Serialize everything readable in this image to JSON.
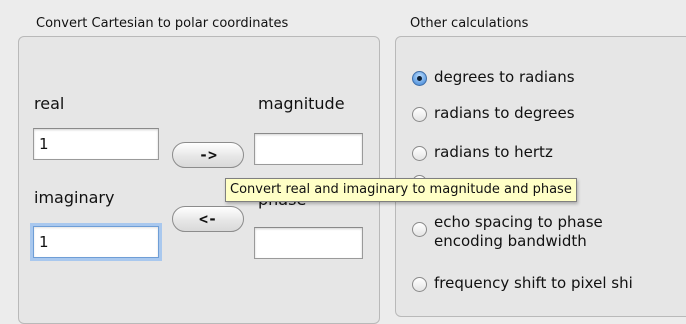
{
  "left_panel": {
    "title": "Convert Cartesian to polar coordinates",
    "real_label": "real",
    "imaginary_label": "imaginary",
    "magnitude_label": "magnitude",
    "phase_label": "phase",
    "real_value": "1",
    "imaginary_value": "1",
    "magnitude_value": "",
    "phase_value": "",
    "convert_forward_label": "->",
    "convert_backward_label": "<-"
  },
  "right_panel": {
    "title": "Other calculations",
    "options": [
      {
        "label": "degrees to radians",
        "selected": true
      },
      {
        "label": "radians to degrees",
        "selected": false
      },
      {
        "label": "radians to hertz",
        "selected": false
      },
      {
        "label": "",
        "selected": false
      },
      {
        "label_line1": "echo spacing to phase",
        "label_line2": "encoding bandwidth",
        "selected": false
      },
      {
        "label": "frequency shift to pixel shi",
        "selected": false
      }
    ]
  },
  "tooltip": {
    "text": "Convert real and imaginary to magnitude and phase"
  }
}
